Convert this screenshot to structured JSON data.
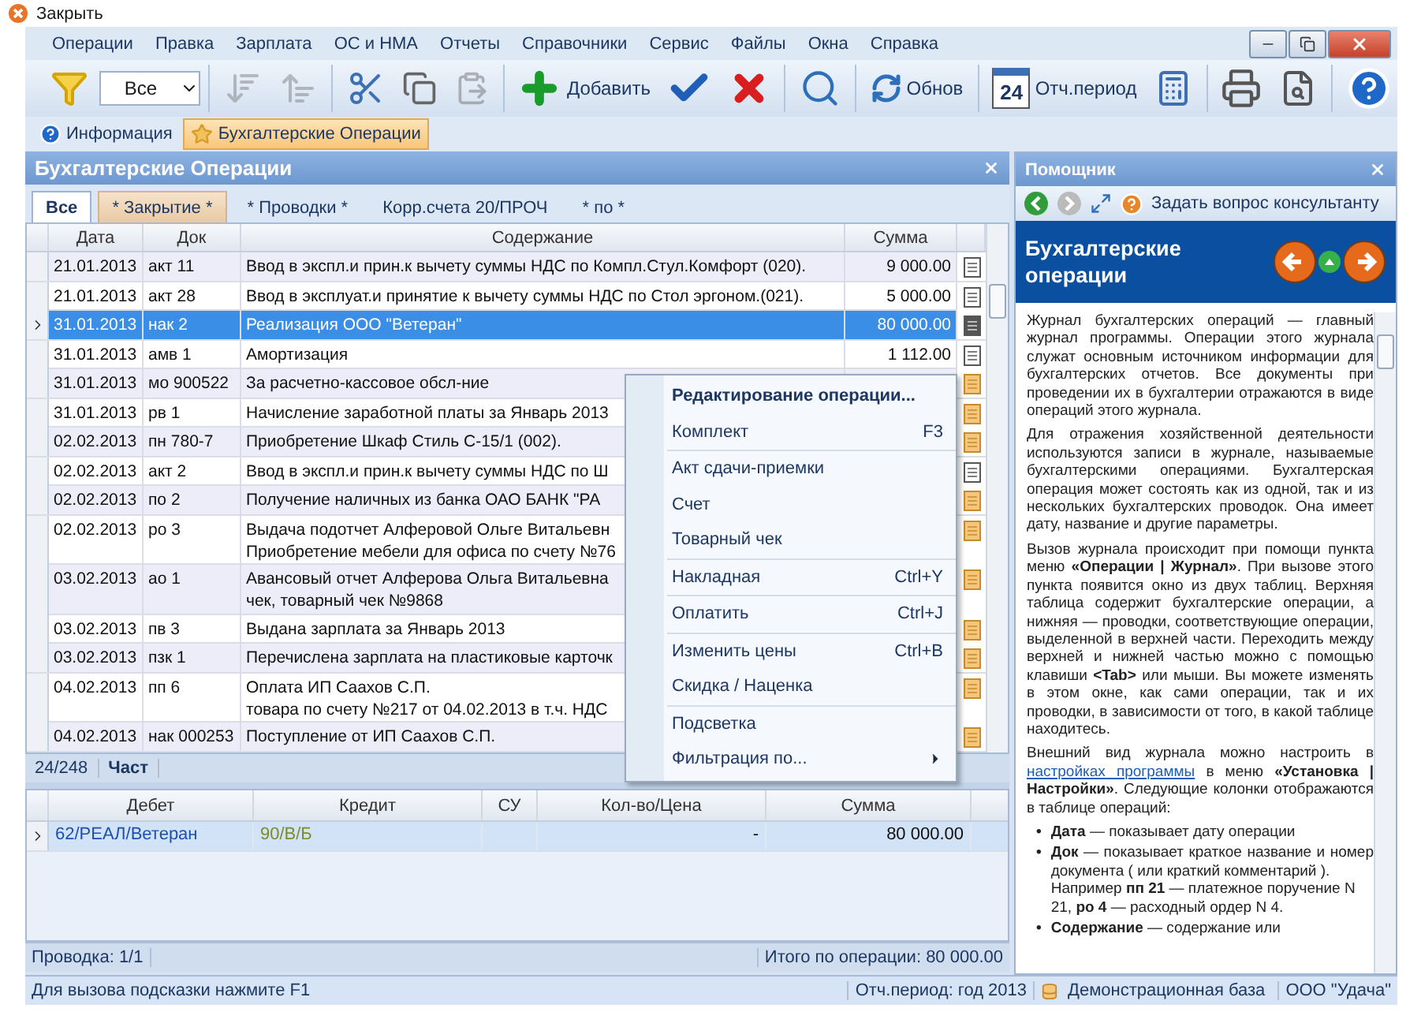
{
  "window": {
    "title": "Закрыть"
  },
  "menu": [
    "Операции",
    "Правка",
    "Зарплата",
    "ОС и НМА",
    "Отчеты",
    "Справочники",
    "Сервис",
    "Файлы",
    "Окна",
    "Справка"
  ],
  "toolbar": [
    {
      "kind": "button",
      "disabled": false
    },
    {
      "kind": "select",
      "value": "Все"
    },
    {
      "kind": "separator"
    },
    {
      "kind": "button",
      "disabled": true
    },
    {
      "kind": "button",
      "disabled": true
    },
    {
      "kind": "separator"
    },
    {
      "kind": "button",
      "disabled": false
    },
    {
      "kind": "button",
      "disabled": false
    },
    {
      "kind": "button",
      "disabled": true
    },
    {
      "kind": "separator"
    },
    {
      "kind": "button",
      "disabled": false,
      "label": "Добавить"
    },
    {
      "kind": "button",
      "disabled": false
    },
    {
      "kind": "button",
      "disabled": false
    },
    {
      "kind": "separator"
    },
    {
      "kind": "button",
      "disabled": false
    },
    {
      "kind": "separator"
    },
    {
      "kind": "button",
      "disabled": false,
      "label": "Обнов"
    },
    {
      "kind": "separator"
    },
    {
      "kind": "calendar",
      "day": "24",
      "label": "Отч.период"
    },
    {
      "kind": "button",
      "disabled": false
    },
    {
      "kind": "separator"
    },
    {
      "kind": "button",
      "disabled": false
    },
    {
      "kind": "button",
      "disabled": false
    },
    {
      "kind": "separator"
    },
    {
      "kind": "button",
      "disabled": false
    }
  ],
  "window_tabs": [
    {
      "label": "Информация",
      "selected": false
    },
    {
      "label": "Бухгалтерские Операции",
      "selected": true
    }
  ],
  "journal": {
    "title": "Бухгалтерские Операции",
    "filters": [
      {
        "label": "Все",
        "selected": true,
        "marked": false
      },
      {
        "label": "* Закрытие *",
        "selected": false,
        "marked": true
      },
      {
        "label": "* Проводки *",
        "selected": false,
        "marked": false
      },
      {
        "label": "Корр.счета 20/ПРОЧ",
        "selected": false,
        "marked": false
      },
      {
        "label": "* по *",
        "selected": false,
        "marked": false
      }
    ],
    "columns": [
      "Дата",
      "Док",
      "Содержание",
      "Сумма"
    ],
    "rows": [
      {
        "date": "21.01.2013",
        "doc": "акт 11",
        "content": [
          "Ввод в экспл.и прин.к вычету суммы НДС по Компл.Стул.Комфорт (020)."
        ],
        "sum": "9 000.00",
        "selected": false,
        "kind": "plain"
      },
      {
        "date": "21.01.2013",
        "doc": "акт 28",
        "content": [
          "Ввод в эксплуат.и принятие к вычету суммы НДС по Стол эргоном.(021)."
        ],
        "sum": "5 000.00",
        "selected": false,
        "kind": "plain"
      },
      {
        "date": "31.01.2013",
        "doc": "нак 2",
        "content": [
          "Реализация ООО \"Ветеран\""
        ],
        "sum": "80 000.00",
        "selected": true,
        "kind": "plain"
      },
      {
        "date": "31.01.2013",
        "doc": "амв 1",
        "content": [
          "Амортизация"
        ],
        "sum": "1 112.00",
        "selected": false,
        "kind": "plain"
      },
      {
        "date": "31.01.2013",
        "doc": "мо 900522",
        "content": [
          "За расчетно-кассовое обсл-ние"
        ],
        "selected": false,
        "kind": "orange"
      },
      {
        "date": "31.01.2013",
        "doc": "рв 1",
        "content": [
          "Начисление заработной платы за Январь 2013"
        ],
        "selected": false,
        "kind": "orange"
      },
      {
        "date": "02.02.2013",
        "doc": "пн 780-7",
        "content": [
          "Приобретение Шкаф Стиль С-15/1 (002)."
        ],
        "selected": false,
        "kind": "orange"
      },
      {
        "date": "02.02.2013",
        "doc": "акт 2",
        "content": [
          "Ввод в экспл.и прин.к вычету суммы НДС по Ш"
        ],
        "selected": false,
        "kind": "plain"
      },
      {
        "date": "02.02.2013",
        "doc": "по 2",
        "content": [
          "Получение наличных из банка ОАО БАНК \"РА"
        ],
        "selected": false,
        "kind": "orange"
      },
      {
        "date": "02.02.2013",
        "doc": "ро 3",
        "content": [
          "Выдача подотчет Алферовой Ольге Витальевн",
          "Приобретение мебели для офиса по счету №76"
        ],
        "selected": false,
        "kind": "orange"
      },
      {
        "date": "03.02.2013",
        "doc": "ао 1",
        "content": [
          "Авансовый отчет Алферова Ольга Витальевна",
          "чек, товарный чек №9868"
        ],
        "selected": false,
        "kind": "orange"
      },
      {
        "date": "03.02.2013",
        "doc": "пв 3",
        "content": [
          "Выдана зарплата за Январь 2013"
        ],
        "selected": false,
        "kind": "orange"
      },
      {
        "date": "03.02.2013",
        "doc": "пзк 1",
        "content": [
          "Перечислена зарплата на пластиковые карточк"
        ],
        "selected": false,
        "kind": "orange"
      },
      {
        "date": "04.02.2013",
        "doc": "пп 6",
        "content": [
          "Оплата ИП Саахов С.П.",
          "товара по счету №217 от 04.02.2013 в т.ч. НДС"
        ],
        "selected": false,
        "kind": "orange"
      },
      {
        "date": "04.02.2013",
        "doc": "нак 000253",
        "content": [
          "Поступление от ИП Саахов С.П."
        ],
        "selected": false,
        "kind": "orange"
      }
    ],
    "counter": "24/248",
    "mode": "Част"
  },
  "context_menu": [
    {
      "label": "Редактирование операции...",
      "kind": "default"
    },
    {
      "label": "Комплект",
      "shortcut": "F3",
      "kind": "item"
    },
    {
      "kind": "separator"
    },
    {
      "label": "Акт сдачи-приемки",
      "kind": "item"
    },
    {
      "label": "Счет",
      "kind": "item"
    },
    {
      "label": "Товарный чек",
      "kind": "item"
    },
    {
      "kind": "separator"
    },
    {
      "label": "Накладная",
      "shortcut": "Ctrl+Y",
      "kind": "item"
    },
    {
      "kind": "separator"
    },
    {
      "label": "Оплатить",
      "shortcut": "Ctrl+J",
      "kind": "item"
    },
    {
      "kind": "separator"
    },
    {
      "label": "Изменить цены",
      "shortcut": "Ctrl+B",
      "kind": "item"
    },
    {
      "label": "Скидка / Наценка",
      "kind": "item"
    },
    {
      "kind": "separator"
    },
    {
      "label": "Подсветка",
      "kind": "item"
    },
    {
      "label": "Фильтрация по...",
      "kind": "submenu"
    }
  ],
  "entries": {
    "columns": [
      "Дебет",
      "Кредит",
      "СУ",
      "Кол-во/Цена",
      "Сумма"
    ],
    "rows": [
      {
        "debit": "62/РЕАЛ/Ветеран",
        "credit": "90/В/Б",
        "qty": "-",
        "sum": "80 000.00",
        "selected": true
      }
    ],
    "footer_left": "Проводка: 1/1",
    "footer_right": "Итого по операции: 80 000.00"
  },
  "assistant": {
    "title": "Помощник",
    "ask": "Задать вопрос консультанту",
    "heading": "Бухгалтерские операции",
    "paragraphs": [
      "Журнал бухгалтерских операций — главный журнал программы. Операции этого журнала служат основным источником информации для бухгалтерских отчетов. Все документы при проведении их в бухгалтерии отражаются в виде операций этого журнала.",
      "Для отражения хозяйственной деятельности используются записи в журнале, называемые бухгалтерскими операциями. Бухгалтерская операция может состоять как из одной, так и из нескольких бухгалтерских проводок. Она имеет дату, название и другие параметры.",
      "Вызов журнала происходит при помощи пункта меню **«Операции | Журнал»**. При вызове этого пункта появится окно из двух таблиц. Верхняя таблица содержит бухгалтерские операции, а нижняя — проводки, соответствующие операции, выделенной в верхней части. Переходить между верхней и нижней частью можно с помощью клавиши **<Tab>** или мыши. Вы можете изменять в этом окне, как сами операции, так и их проводки, в зависимости от того, в какой таблице находитесь."
    ],
    "link_paragraph": {
      "before": "Внешний вид журнала можно настроить в",
      "link": "настройках программы",
      "after": "в меню **«Установка | Настройки»**. Следующие колонки отображаются в таблице операций:"
    },
    "bullets": [
      {
        "marker": "•",
        "text": "**Дата** — показывает дату операции"
      },
      {
        "marker": "•",
        "text": "**Док** — показывает краткое название и номер документа ( или краткий комментарий ).",
        "note": "Например **пп 21** — платежное поручение N 21, **ро 4** — расходный ордер N 4."
      },
      {
        "marker": "•",
        "text": "**Содержание** — содержание или"
      }
    ]
  },
  "status_bar": {
    "hint": "Для вызова подсказки нажмите F1",
    "period": "Отч.период: год 2013",
    "database": "Демонстрационная база",
    "company": "ООО \"Удача\""
  }
}
